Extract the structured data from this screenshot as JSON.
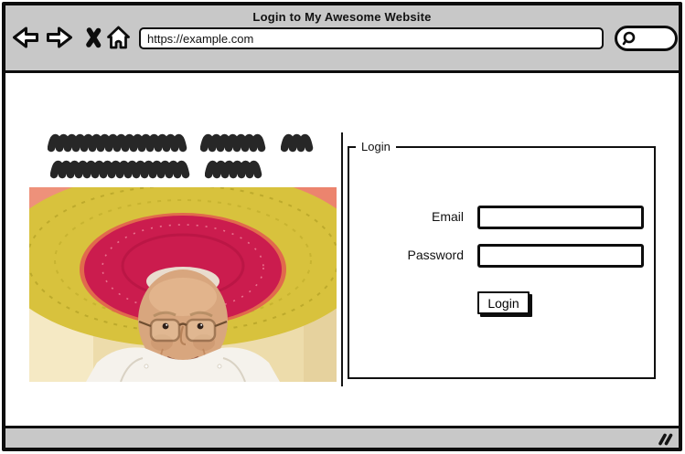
{
  "window": {
    "title": "Login to My Awesome Website"
  },
  "browser": {
    "url": "https://example.com",
    "nav_icons": [
      "back-arrow",
      "forward-arrow",
      "close-x",
      "home"
    ],
    "search_icon": "magnifier"
  },
  "page": {
    "photo_alt": "Elderly woman wearing a colorful sombrero",
    "placeholder_text": "scribble placeholder, 2 rows",
    "form": {
      "legend": "Login",
      "email_label": "Email",
      "email_value": "",
      "password_label": "Password",
      "password_value": "",
      "submit_label": "Login"
    }
  },
  "status_bar": {
    "resize_grip": "double-slash"
  },
  "colors": {
    "chrome_gray": "#c8c8c8",
    "ink": "#0d0d0d",
    "sombrero_salmon": "#e2604e",
    "sombrero_yellow": "#d8c23d",
    "sombrero_crimson": "#cb1c4e",
    "wall_tan": "#eddcab"
  }
}
